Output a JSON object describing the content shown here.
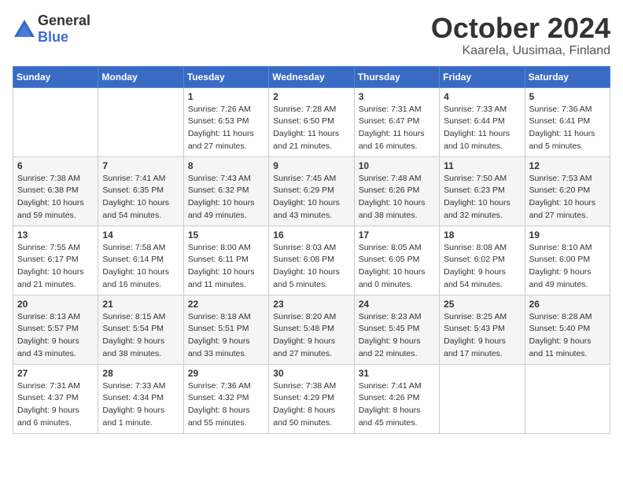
{
  "header": {
    "logo": {
      "general": "General",
      "blue": "Blue"
    },
    "title": "October 2024",
    "location": "Kaarela, Uusimaa, Finland"
  },
  "days_of_week": [
    "Sunday",
    "Monday",
    "Tuesday",
    "Wednesday",
    "Thursday",
    "Friday",
    "Saturday"
  ],
  "weeks": [
    [
      {
        "day": "",
        "info": ""
      },
      {
        "day": "",
        "info": ""
      },
      {
        "day": "1",
        "info": "Sunrise: 7:26 AM\nSunset: 6:53 PM\nDaylight: 11 hours\nand 27 minutes."
      },
      {
        "day": "2",
        "info": "Sunrise: 7:28 AM\nSunset: 6:50 PM\nDaylight: 11 hours\nand 21 minutes."
      },
      {
        "day": "3",
        "info": "Sunrise: 7:31 AM\nSunset: 6:47 PM\nDaylight: 11 hours\nand 16 minutes."
      },
      {
        "day": "4",
        "info": "Sunrise: 7:33 AM\nSunset: 6:44 PM\nDaylight: 11 hours\nand 10 minutes."
      },
      {
        "day": "5",
        "info": "Sunrise: 7:36 AM\nSunset: 6:41 PM\nDaylight: 11 hours\nand 5 minutes."
      }
    ],
    [
      {
        "day": "6",
        "info": "Sunrise: 7:38 AM\nSunset: 6:38 PM\nDaylight: 10 hours\nand 59 minutes."
      },
      {
        "day": "7",
        "info": "Sunrise: 7:41 AM\nSunset: 6:35 PM\nDaylight: 10 hours\nand 54 minutes."
      },
      {
        "day": "8",
        "info": "Sunrise: 7:43 AM\nSunset: 6:32 PM\nDaylight: 10 hours\nand 49 minutes."
      },
      {
        "day": "9",
        "info": "Sunrise: 7:45 AM\nSunset: 6:29 PM\nDaylight: 10 hours\nand 43 minutes."
      },
      {
        "day": "10",
        "info": "Sunrise: 7:48 AM\nSunset: 6:26 PM\nDaylight: 10 hours\nand 38 minutes."
      },
      {
        "day": "11",
        "info": "Sunrise: 7:50 AM\nSunset: 6:23 PM\nDaylight: 10 hours\nand 32 minutes."
      },
      {
        "day": "12",
        "info": "Sunrise: 7:53 AM\nSunset: 6:20 PM\nDaylight: 10 hours\nand 27 minutes."
      }
    ],
    [
      {
        "day": "13",
        "info": "Sunrise: 7:55 AM\nSunset: 6:17 PM\nDaylight: 10 hours\nand 21 minutes."
      },
      {
        "day": "14",
        "info": "Sunrise: 7:58 AM\nSunset: 6:14 PM\nDaylight: 10 hours\nand 16 minutes."
      },
      {
        "day": "15",
        "info": "Sunrise: 8:00 AM\nSunset: 6:11 PM\nDaylight: 10 hours\nand 11 minutes."
      },
      {
        "day": "16",
        "info": "Sunrise: 8:03 AM\nSunset: 6:08 PM\nDaylight: 10 hours\nand 5 minutes."
      },
      {
        "day": "17",
        "info": "Sunrise: 8:05 AM\nSunset: 6:05 PM\nDaylight: 10 hours\nand 0 minutes."
      },
      {
        "day": "18",
        "info": "Sunrise: 8:08 AM\nSunset: 6:02 PM\nDaylight: 9 hours\nand 54 minutes."
      },
      {
        "day": "19",
        "info": "Sunrise: 8:10 AM\nSunset: 6:00 PM\nDaylight: 9 hours\nand 49 minutes."
      }
    ],
    [
      {
        "day": "20",
        "info": "Sunrise: 8:13 AM\nSunset: 5:57 PM\nDaylight: 9 hours\nand 43 minutes."
      },
      {
        "day": "21",
        "info": "Sunrise: 8:15 AM\nSunset: 5:54 PM\nDaylight: 9 hours\nand 38 minutes."
      },
      {
        "day": "22",
        "info": "Sunrise: 8:18 AM\nSunset: 5:51 PM\nDaylight: 9 hours\nand 33 minutes."
      },
      {
        "day": "23",
        "info": "Sunrise: 8:20 AM\nSunset: 5:48 PM\nDaylight: 9 hours\nand 27 minutes."
      },
      {
        "day": "24",
        "info": "Sunrise: 8:23 AM\nSunset: 5:45 PM\nDaylight: 9 hours\nand 22 minutes."
      },
      {
        "day": "25",
        "info": "Sunrise: 8:25 AM\nSunset: 5:43 PM\nDaylight: 9 hours\nand 17 minutes."
      },
      {
        "day": "26",
        "info": "Sunrise: 8:28 AM\nSunset: 5:40 PM\nDaylight: 9 hours\nand 11 minutes."
      }
    ],
    [
      {
        "day": "27",
        "info": "Sunrise: 7:31 AM\nSunset: 4:37 PM\nDaylight: 9 hours\nand 6 minutes."
      },
      {
        "day": "28",
        "info": "Sunrise: 7:33 AM\nSunset: 4:34 PM\nDaylight: 9 hours\nand 1 minute."
      },
      {
        "day": "29",
        "info": "Sunrise: 7:36 AM\nSunset: 4:32 PM\nDaylight: 8 hours\nand 55 minutes."
      },
      {
        "day": "30",
        "info": "Sunrise: 7:38 AM\nSunset: 4:29 PM\nDaylight: 8 hours\nand 50 minutes."
      },
      {
        "day": "31",
        "info": "Sunrise: 7:41 AM\nSunset: 4:26 PM\nDaylight: 8 hours\nand 45 minutes."
      },
      {
        "day": "",
        "info": ""
      },
      {
        "day": "",
        "info": ""
      }
    ]
  ]
}
